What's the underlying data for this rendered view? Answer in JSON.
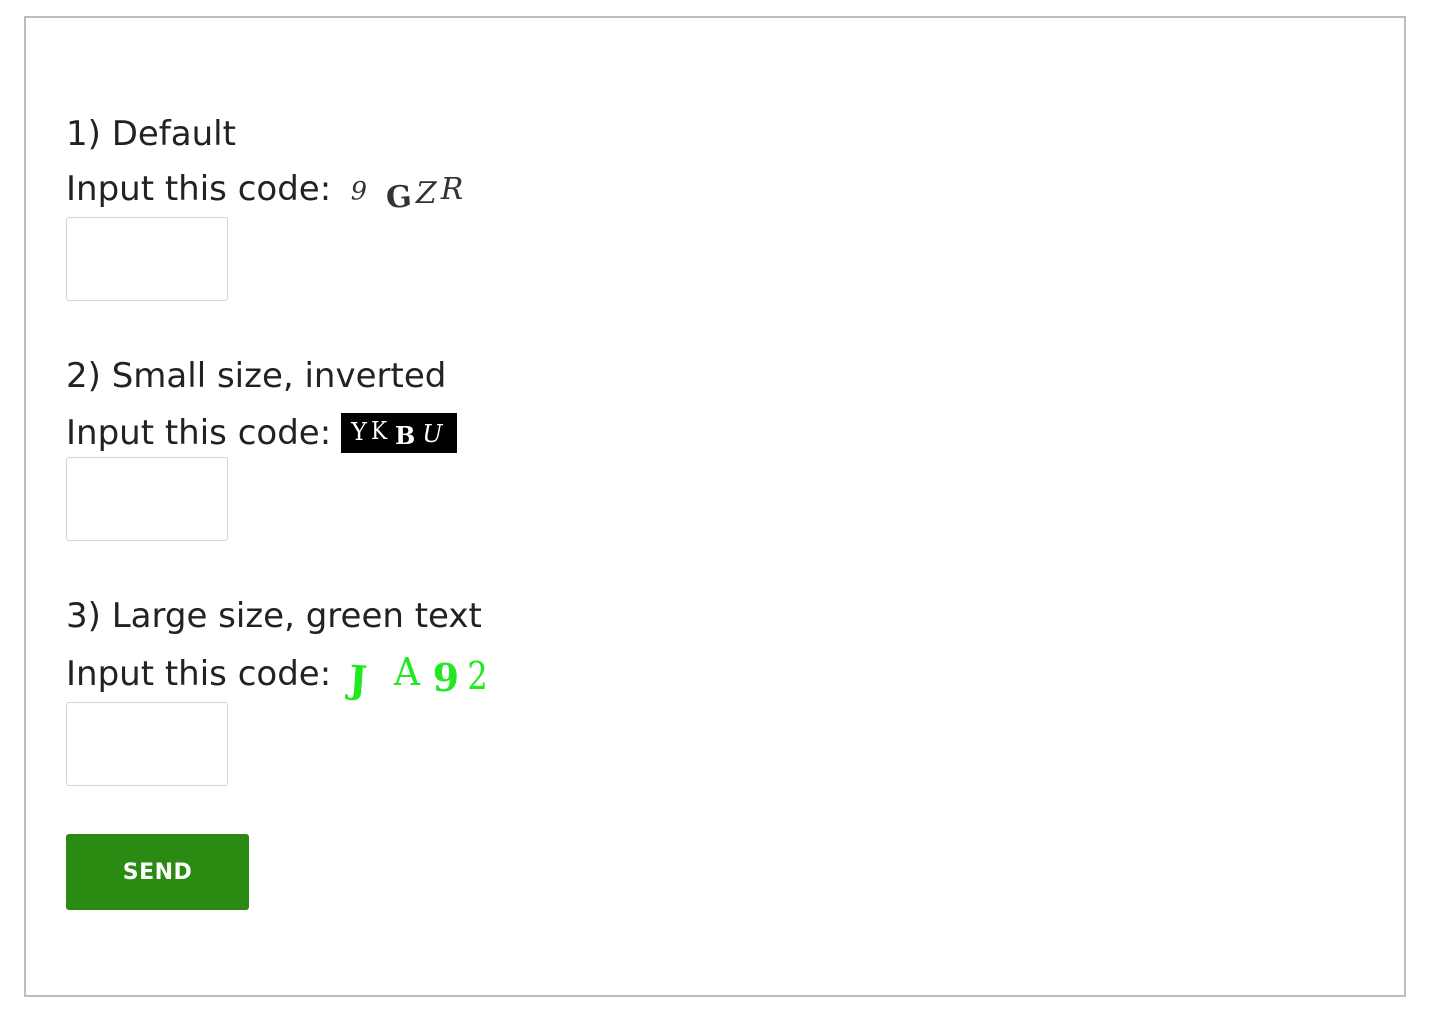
{
  "form": {
    "sections": [
      {
        "title": "1) Default",
        "prompt": "Input this code:",
        "captcha": [
          "9",
          "G",
          "Z",
          "R"
        ],
        "input_value": ""
      },
      {
        "title": "2) Small size, inverted",
        "prompt": "Input this code:",
        "captcha": [
          "Y",
          "K",
          "B",
          "U"
        ],
        "input_value": ""
      },
      {
        "title": "3) Large size, green text",
        "prompt": "Input this code:",
        "captcha": [
          "J",
          "A",
          "9",
          "2"
        ],
        "input_value": ""
      }
    ],
    "send_label": "SEND"
  },
  "colors": {
    "frame_border": "#bdbdbd",
    "button_bg": "#2a8a12",
    "button_text": "#ffffff",
    "inverted_captcha_bg": "#000000",
    "inverted_captcha_text": "#ffffff",
    "green_captcha_text": "#22e822"
  }
}
